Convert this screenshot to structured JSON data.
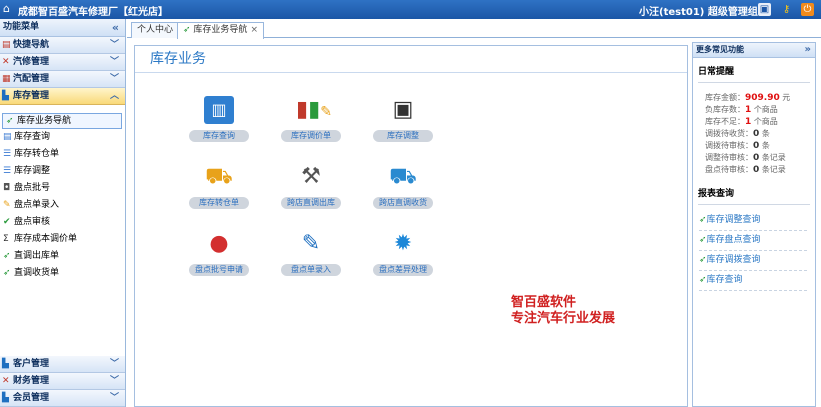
{
  "topbar": {
    "app_title": "成都智百盛汽车修理厂【红光店】",
    "user_text": "小汪(test01) 超级管理组"
  },
  "sidebar": {
    "title": "功能菜单",
    "collapse_glyph": "«",
    "sections": [
      {
        "label": "快捷导航",
        "icon": "shortcut-icon"
      },
      {
        "label": "汽修管理",
        "icon": "wrench-icon"
      },
      {
        "label": "汽配管理",
        "icon": "parts-icon"
      },
      {
        "label": "库存管理",
        "icon": "inventory-icon",
        "active": true
      }
    ],
    "sub_items": [
      {
        "label": "库存业务导航",
        "icon": "nav-icon",
        "selected": true
      },
      {
        "label": "库存查询",
        "icon": "document-icon"
      },
      {
        "label": "库存转仓单",
        "icon": "list-icon"
      },
      {
        "label": "库存调整",
        "icon": "list-icon"
      },
      {
        "label": "盘点批号",
        "icon": "box-icon"
      },
      {
        "label": "盘点单录入",
        "icon": "pencil-icon"
      },
      {
        "label": "盘点审核",
        "icon": "check-icon"
      },
      {
        "label": "库存成本调价单",
        "icon": "sigma-icon"
      },
      {
        "label": "直调出库单",
        "icon": "truck-icon"
      },
      {
        "label": "直调收货单",
        "icon": "truck-icon"
      }
    ],
    "bottom_sections": [
      {
        "label": "客户管理",
        "icon": "customer-icon"
      },
      {
        "label": "财务管理",
        "icon": "finance-icon"
      },
      {
        "label": "会员管理",
        "icon": "member-icon"
      }
    ]
  },
  "tabs": [
    {
      "label": "个人中心"
    },
    {
      "label": "库存业务导航",
      "active": true,
      "close": "×"
    }
  ],
  "main": {
    "title": "库存业务",
    "functions": [
      {
        "label": "库存查询",
        "icon": "bar-chart-icon",
        "glyph": "▥",
        "color": "#1e6fc0"
      },
      {
        "label": "库存调价单",
        "icon": "chart-pen-icon",
        "glyph": "▮",
        "color": "#c0392b"
      },
      {
        "label": "库存调整",
        "icon": "floppy-icon",
        "glyph": "▣",
        "color": "#333333"
      },
      {
        "label": "库存转仓单",
        "icon": "truck-icon",
        "glyph": "⛟",
        "color": "#e8a21a"
      },
      {
        "label": "跨店直调出库",
        "icon": "hand-truck-icon",
        "glyph": "⚒",
        "color": "#555555"
      },
      {
        "label": "跨店直调收货",
        "icon": "truck-receive-icon",
        "glyph": "⛟",
        "color": "#2a8ad0"
      },
      {
        "label": "盘点批号申请",
        "icon": "new-badge-icon",
        "glyph": "●",
        "color": "#d32f2f"
      },
      {
        "label": "盘点单录入",
        "icon": "form-pen-icon",
        "glyph": "✎",
        "color": "#1e6fc0"
      },
      {
        "label": "盘点差异处理",
        "icon": "gear-icon",
        "glyph": "✹",
        "color": "#1e88d8"
      }
    ],
    "brand_line1": "智百盛软件",
    "brand_line2": "专注汽车行业发展"
  },
  "right_panel": {
    "header": "更多常见功能",
    "reminder_title": "日常提醒",
    "reminders": [
      {
        "label": "库存金额：",
        "value": "909.90",
        "unit": "元",
        "red": true
      },
      {
        "label": "负库存数：",
        "value": "1",
        "unit": "个商品",
        "red": true
      },
      {
        "label": "库存不足：",
        "value": "1",
        "unit": "个商品",
        "red": true
      },
      {
        "label": "调拨待收货：",
        "value": "0",
        "unit": "条",
        "red": false
      },
      {
        "label": "调拨待审核：",
        "value": "0",
        "unit": "条",
        "red": false
      },
      {
        "label": "调整待审核：",
        "value": "0",
        "unit": "条记录",
        "red": false
      },
      {
        "label": "盘点待审核：",
        "value": "0",
        "unit": "条记录",
        "red": false
      }
    ],
    "report_title": "报表查询",
    "reports": [
      {
        "label": "库存调整查询"
      },
      {
        "label": "库存盘点查询"
      },
      {
        "label": "库存调拨查询"
      },
      {
        "label": "库存查询"
      }
    ]
  }
}
